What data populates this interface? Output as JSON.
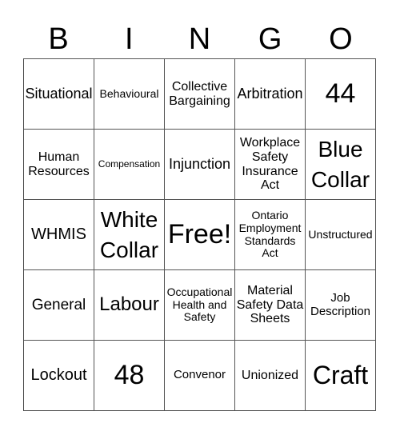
{
  "header": {
    "letters": [
      "B",
      "I",
      "N",
      "G",
      "O"
    ]
  },
  "cells": [
    "Situational",
    "Behavioural",
    "Collective Bargaining",
    "Arbitration",
    "44",
    "Human Resources",
    "Compensation",
    "Injunction",
    "Workplace Safety Insurance Act",
    "Blue Collar",
    "WHMIS",
    "White Collar",
    "Free!",
    "Ontario Employment Standards Act",
    "Unstructured",
    "General",
    "Labour",
    "Occupational Health and Safety",
    "Material Safety Data Sheets",
    "Job Description",
    "Lockout",
    "48",
    "Convenor",
    "Unionized",
    "Craft"
  ]
}
